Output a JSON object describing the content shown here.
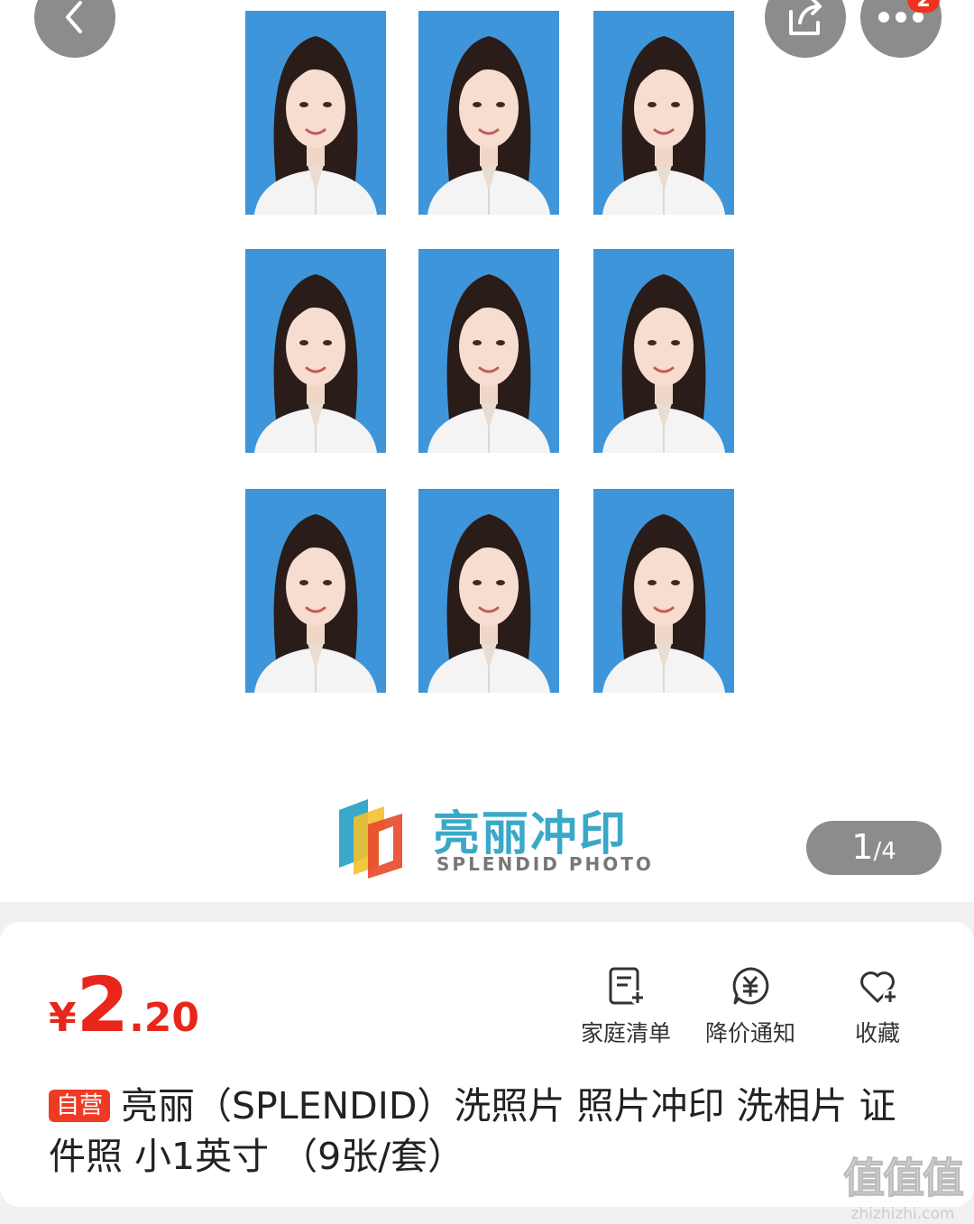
{
  "gallery": {
    "counter_current": "1",
    "counter_total": "/4",
    "share_badge": "2",
    "brand_name_cn": "亮丽冲印",
    "brand_name_en": "SPLENDID PHOTO",
    "photo_background": "#3f95d9"
  },
  "icons": {
    "back": "chevron-left-icon",
    "share": "share-icon",
    "more": "more-dots-icon",
    "family_list": "list-add-icon",
    "price_alert": "price-alert-icon",
    "favorite": "heart-add-icon"
  },
  "product": {
    "currency": "¥",
    "price_int": "2",
    "price_dec": ".20",
    "tag": "自营",
    "title": "亮丽（SPLENDID）洗照片 照片冲印 洗相片 证件照 小1英寸 （9张/套）"
  },
  "actions": {
    "family_list": "家庭清单",
    "price_alert": "降价通知",
    "favorite": "收藏"
  },
  "watermark": {
    "logo": "值值值",
    "site": "zhizhizhi.com"
  },
  "colors": {
    "price_red": "#e8261b",
    "tag_red": "#ef3a24"
  }
}
